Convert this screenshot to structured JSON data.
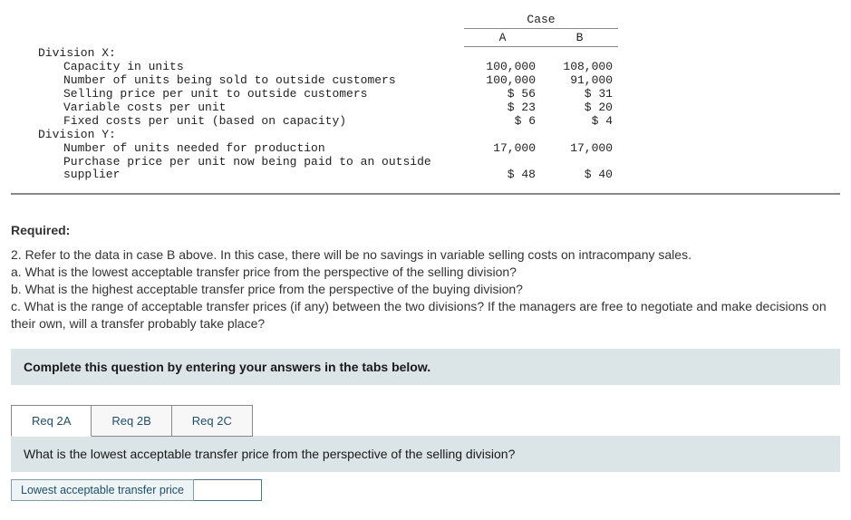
{
  "table": {
    "case_label": "Case",
    "col_a": "A",
    "col_b": "B",
    "divx_label": "Division X:",
    "rows_x": [
      {
        "label": "Capacity in units",
        "a": "100,000",
        "b": "108,000"
      },
      {
        "label": "Number of units being sold to outside customers",
        "a": "100,000",
        "b": "91,000"
      },
      {
        "label": "Selling price per unit to outside customers",
        "a": "$ 56",
        "b": "$ 31"
      },
      {
        "label": "Variable costs per unit",
        "a": "$ 23",
        "b": "$ 20"
      },
      {
        "label": "Fixed costs per unit (based on capacity)",
        "a": "$ 6",
        "b": "$ 4"
      }
    ],
    "divy_label": "Division Y:",
    "rows_y": [
      {
        "label": "Number of units needed for production",
        "a": "17,000",
        "b": "17,000"
      },
      {
        "label": "Purchase price per unit now being paid to an outside supplier",
        "a": "$ 48",
        "b": "$ 40"
      }
    ]
  },
  "required": {
    "heading": "Required:",
    "q2_intro": "2. Refer to the data in case B above. In this case, there will be no savings in variable selling costs on intracompany sales.",
    "q2a": "a. What is the lowest acceptable transfer price from the perspective of the selling division?",
    "q2b": "b. What is the highest acceptable transfer price from the perspective of the buying division?",
    "q2c": "c. What is the range of acceptable transfer prices (if any) between the two divisions? If the managers are free to negotiate and make decisions on their own, will a transfer probably take place?"
  },
  "instruction": "Complete this question by entering your answers in the tabs below.",
  "tabs": {
    "t2a": "Req 2A",
    "t2b": "Req 2B",
    "t2c": "Req 2C"
  },
  "question_prompt": "What is the lowest acceptable transfer price from the perspective of the selling division?",
  "input_label": "Lowest acceptable transfer price"
}
